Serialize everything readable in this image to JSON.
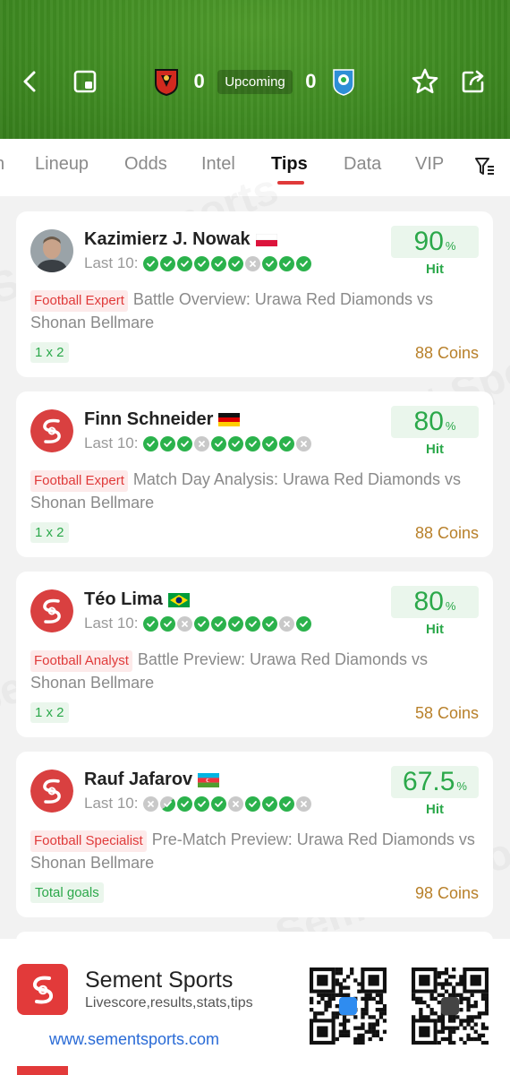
{
  "header": {
    "home_score": "0",
    "away_score": "0",
    "status": "Upcoming",
    "icons": [
      "back-icon",
      "window-icon",
      "star-icon",
      "share-icon"
    ]
  },
  "tabs": [
    "Lineup",
    "Odds",
    "Intel",
    "Tips",
    "Data",
    "VIP"
  ],
  "active_tab": "Tips",
  "watermark": "Sement Sports",
  "cards": [
    {
      "name": "Kazimierz J. Nowak",
      "flag": "poland",
      "last_label": "Last 10:",
      "results": [
        "w",
        "w",
        "w",
        "w",
        "w",
        "w",
        "l",
        "w",
        "w",
        "w"
      ],
      "hit": "90",
      "hit_unit": "%",
      "hit_label": "Hit",
      "role": "Football Expert",
      "title": "Battle Overview: Urawa Red Diamonds vs Shonan Bellmare",
      "market": "1 x 2",
      "price": "88 Coins"
    },
    {
      "name": "Finn Schneider",
      "flag": "germany",
      "last_label": "Last 10:",
      "results": [
        "w",
        "w",
        "w",
        "l",
        "w",
        "w",
        "w",
        "w",
        "w",
        "l"
      ],
      "hit": "80",
      "hit_unit": "%",
      "hit_label": "Hit",
      "role": "Football Expert",
      "title": "Match Day Analysis: Urawa Red Diamonds vs Shonan Bellmare",
      "market": "1 x 2",
      "price": "88 Coins"
    },
    {
      "name": "Téo Lima",
      "flag": "brazil",
      "last_label": "Last 10:",
      "results": [
        "w",
        "w",
        "l",
        "w",
        "w",
        "w",
        "w",
        "w",
        "l",
        "w"
      ],
      "hit": "80",
      "hit_unit": "%",
      "hit_label": "Hit",
      "role": "Football Analyst",
      "title": "Battle Preview: Urawa Red Diamonds vs Shonan Bellmare",
      "market": "1 x 2",
      "price": "58 Coins"
    },
    {
      "name": "Rauf Jafarov",
      "flag": "azerbaijan",
      "last_label": "Last 10:",
      "results": [
        "l",
        "h",
        "w",
        "w",
        "w",
        "l",
        "w",
        "w",
        "w",
        "l"
      ],
      "hit": "67.5",
      "hit_unit": "%",
      "hit_label": "Hit",
      "role": "Football Specialist",
      "title": "Pre-Match Preview: Urawa Red Diamonds vs Shonan Bellmare",
      "market": "Total goals",
      "price": "98 Coins"
    }
  ],
  "footer": {
    "app_name": "Sement Sports",
    "tagline": "Livescore,results,stats,tips",
    "url": "www.sementsports.com"
  },
  "colors": {
    "accent_red": "#e03a3a",
    "hit_green": "#2ba84a",
    "coins_gold": "#b8802a",
    "link_blue": "#2a6bd6"
  }
}
